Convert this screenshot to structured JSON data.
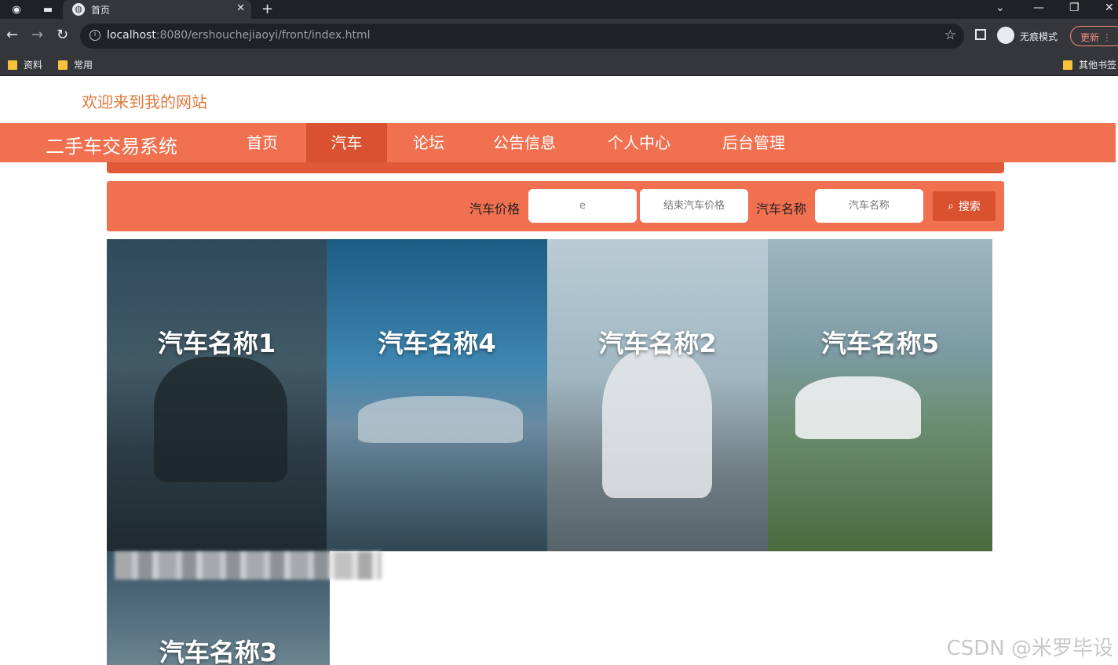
{
  "browser": {
    "tab_title": "首页",
    "url_host": "localhost",
    "url_rest": ":8080/ershouchejiaoyi/front/index.html",
    "incognito_label": "无痕模式",
    "update_label": "更新",
    "bookmarks": [
      "资料",
      "常用"
    ],
    "other_bookmarks": "其他书签"
  },
  "page": {
    "welcome": "欢迎来到我的网站",
    "brand": "二手车交易系统",
    "nav": [
      {
        "label": "首页",
        "active": false
      },
      {
        "label": "汽车",
        "active": true
      },
      {
        "label": "论坛",
        "active": false
      },
      {
        "label": "公告信息",
        "active": false
      },
      {
        "label": "个人中心",
        "active": false
      },
      {
        "label": "后台管理",
        "active": false
      }
    ]
  },
  "search": {
    "price_label": "汽车价格",
    "price_start_value": "e",
    "price_end_placeholder": "结束汽车价格",
    "name_label": "汽车名称",
    "name_placeholder": "汽车名称",
    "button_label": "搜索"
  },
  "cars": [
    {
      "name": "汽车名称1"
    },
    {
      "name": "汽车名称4"
    },
    {
      "name": "汽车名称2"
    },
    {
      "name": "汽车名称5"
    },
    {
      "name": "汽车名称3"
    }
  ],
  "watermark": "CSDN @米罗毕设",
  "colors": {
    "nav_bg": "#f07050",
    "nav_active": "#d9512e",
    "welcome": "#e0783c"
  }
}
